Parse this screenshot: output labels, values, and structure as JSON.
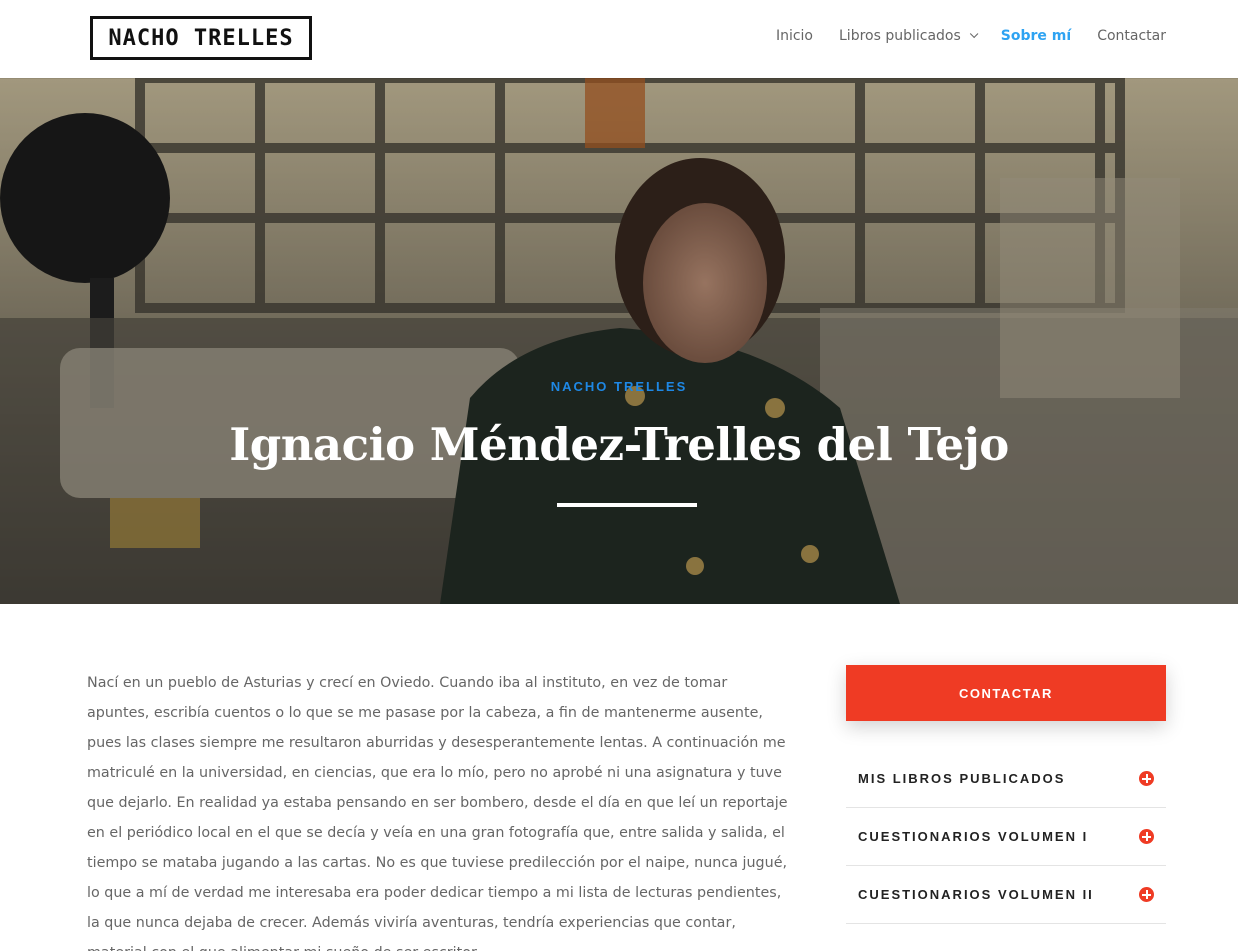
{
  "header": {
    "logo": "NACHO TRELLES",
    "nav": {
      "inicio": "Inicio",
      "libros": "Libros publicados",
      "sobre": "Sobre mí",
      "contactar": "Contactar"
    },
    "active_color": "#2ea3f2"
  },
  "hero": {
    "kicker": "NACHO TRELLES",
    "title": "Ignacio Méndez-Trelles del Tejo"
  },
  "content": {
    "paragraph": "Nací en un pueblo de Asturias y crecí en Oviedo. Cuando iba al instituto, en vez de tomar apuntes, escribía cuentos o lo que se me pasase por la cabeza, a fin de mantenerme ausente, pues las clases siempre me resultaron aburridas y desesperantemente lentas. A continuación me matriculé en la universidad, en ciencias, que era lo mío, pero no aprobé ni una asignatura y tuve que dejarlo. En realidad ya estaba pensando en ser bombero, desde el día en que leí un reportaje en el periódico local en el que se decía y veía en una gran fotografía que, entre salida y salida, el tiempo se mataba jugando a las cartas. No es que tuviese predilección por el naipe, nunca jugué, lo que a mí de verdad me interesaba era poder dedicar tiempo a mi lista de lecturas pendientes, la que nunca dejaba de crecer. Además viviría aventuras, tendría experiencias que contar, material con el que alimentar mi sueño de ser escritor."
  },
  "sidebar": {
    "cta": "CONTACTAR",
    "toggles": [
      {
        "title": "MIS LIBROS PUBLICADOS"
      },
      {
        "title": "CUESTIONARIOS VOLUMEN I"
      },
      {
        "title": "CUESTIONARIOS VOLUMEN II"
      }
    ],
    "accent_color": "#ef3b24"
  }
}
